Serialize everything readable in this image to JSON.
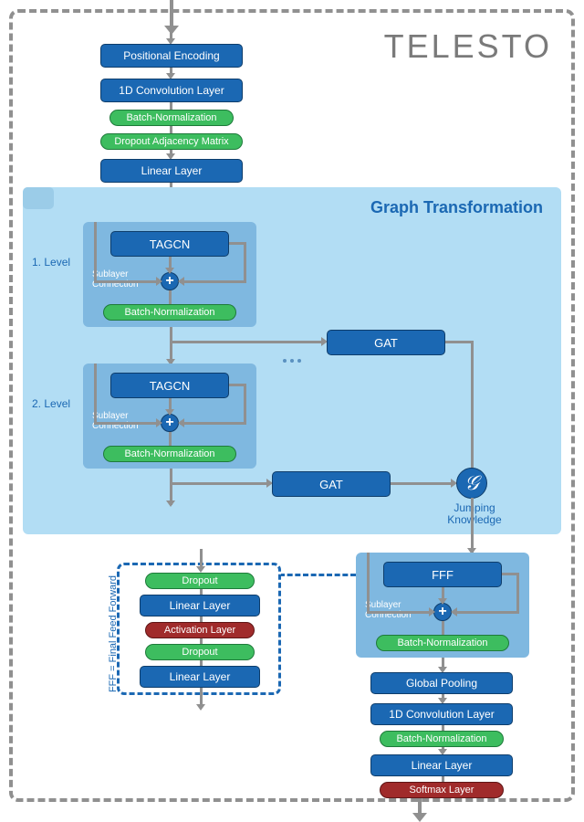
{
  "title": "TELESTO",
  "top_stack": {
    "pe": "Positional Encoding",
    "conv1d": "1D Convolution Layer",
    "bn": "Batch-Normalization",
    "drop_adj": "Dropout Adjacency Matrix",
    "linear": "Linear Layer"
  },
  "graph_transformation": {
    "title": "Graph Transformation",
    "level1": "1. Level",
    "level2": "2. Level",
    "tagcn": "TAGCN",
    "sublayer": "Sublayer\nConnection",
    "bn": "Batch-Normalization",
    "gat": "GAT",
    "jk_symbol": "𝒢",
    "jk_label": "Jumping\nKnowledge"
  },
  "fff": {
    "name": "FFF",
    "sublayer": "Sublayer\nConnection",
    "bn": "Batch-Normalization",
    "detail_label": "FFF = Final Feed Forward",
    "dropout": "Dropout",
    "linear": "Linear Layer",
    "activation": "Activation Layer"
  },
  "bottom_stack": {
    "pool": "Global Pooling",
    "conv1d": "1D Convolution Layer",
    "bn": "Batch-Normalization",
    "linear": "Linear Layer",
    "softmax": "Softmax Layer"
  }
}
